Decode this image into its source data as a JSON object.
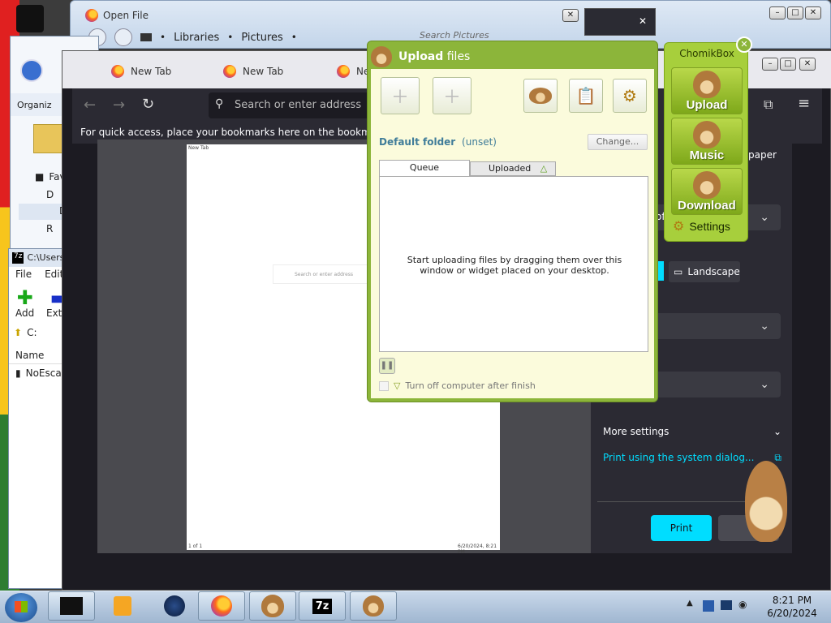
{
  "open_file": {
    "title": "Open File",
    "breadcrumb": [
      "Libraries",
      "Pictures"
    ],
    "search_placeholder": "Search Pictures"
  },
  "explorer_left": {
    "organize_label": "Organiz",
    "favorites_label": "Fav",
    "tree_items": [
      "D",
      "D",
      "R"
    ]
  },
  "seven_zip": {
    "title": "C:\\Users\\",
    "menu": [
      "File",
      "Edit"
    ],
    "toolbar": [
      "Add",
      "Extra"
    ],
    "path": "C:",
    "column_name": "Name",
    "file_name": "NoEscap"
  },
  "firefox": {
    "tabs": [
      "New Tab",
      "New Tab",
      "Ne"
    ],
    "address_placeholder": "Search or enter address",
    "bookmarks_hint": "For quick access, place your bookmarks here on the bookmarks too",
    "preview_header_left": "New Tab",
    "preview_search_text": "Search or enter address",
    "preview_footer_left": "1 of 1",
    "preview_footer_right": "6/20/2024, 8:21 PM"
  },
  "print_panel": {
    "paper_fragment": "paper",
    "of_fragment": "of",
    "landscape_label": "Landscape",
    "more_settings_label": "More settings",
    "system_dialog_link": "Print using the system dialog...",
    "print_button": "Print",
    "accent_color": "#00ddff"
  },
  "upload_dialog": {
    "title_strong": "Upload",
    "title_rest": " files",
    "toolbar_icons": [
      "add-file-icon",
      "add-folder-icon",
      "hamster-icon",
      "clipboard-icon",
      "gear-icon"
    ],
    "default_folder_label": "Default folder",
    "default_folder_value": "(unset)",
    "change_button": "Change...",
    "tab_queue": "Queue",
    "tab_uploaded": "Uploaded",
    "empty_message": "Start uploading files by dragging them over this window or widget placed on your desktop.",
    "turn_off_label": "Turn off computer after finish",
    "background_color": "#fbfbdc",
    "frame_color": "#8cb53a"
  },
  "chomikbox": {
    "title": "ChomikBox",
    "buttons": [
      "Upload",
      "Music",
      "Download"
    ],
    "settings_label": "Settings"
  },
  "taskbar": {
    "time": "8:21 PM",
    "date": "6/20/2024",
    "items": [
      "cmd-window",
      "media-player",
      "circle-app",
      "firefox",
      "chomikbox",
      "7zip",
      "chomikbox-upload"
    ]
  }
}
